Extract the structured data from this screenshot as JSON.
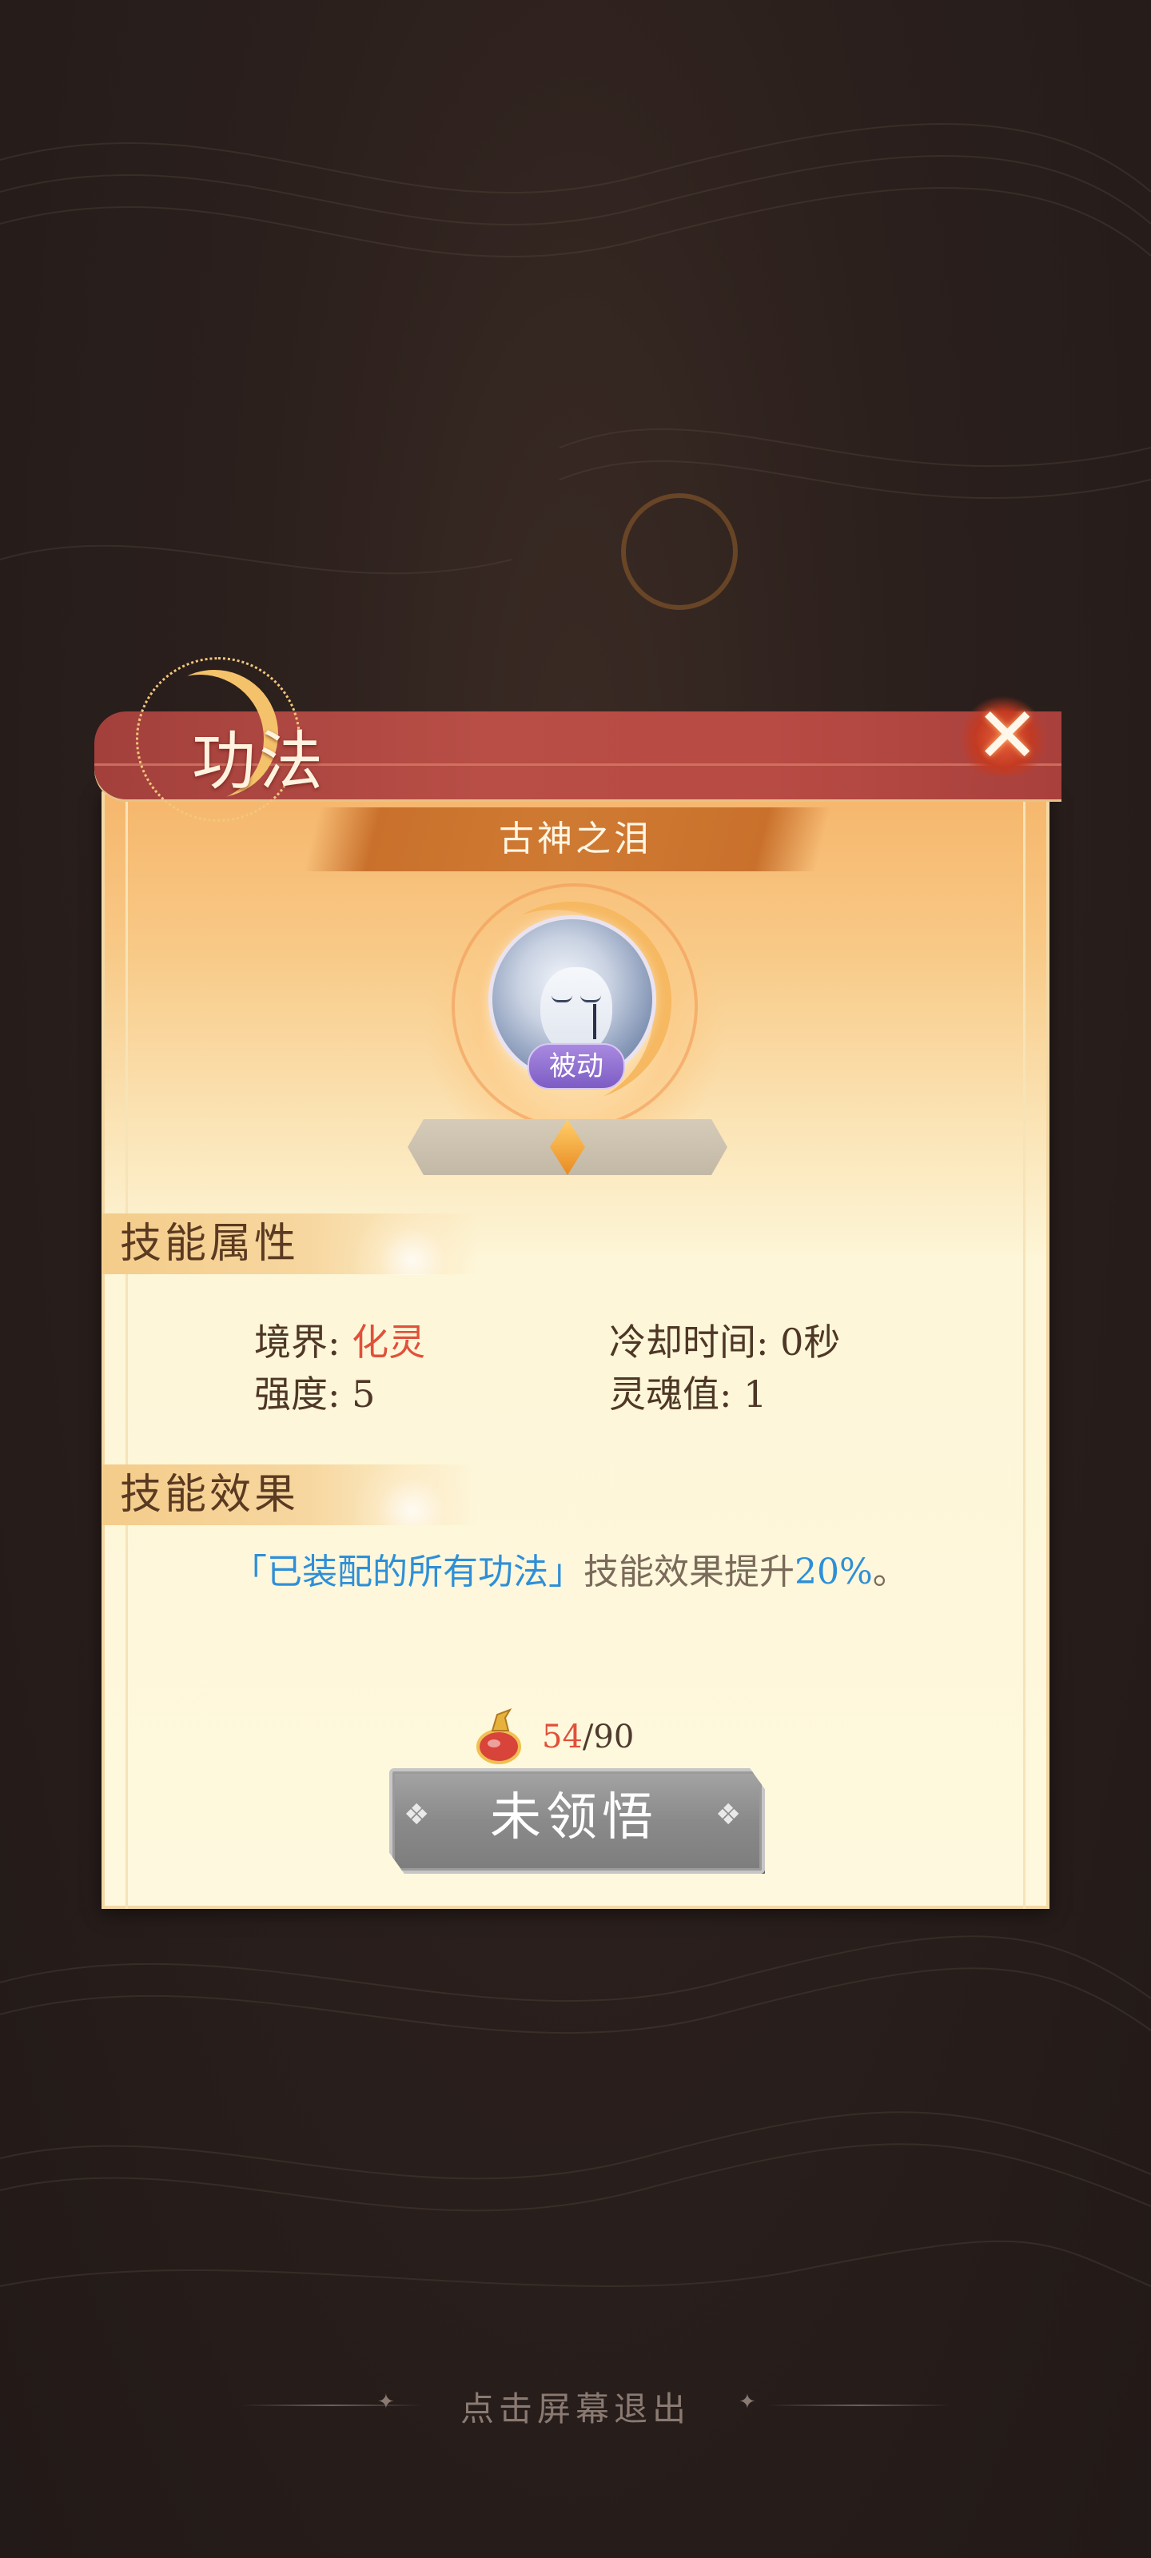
{
  "header": {
    "title": "功法"
  },
  "skill": {
    "name": "古神之泪",
    "type_badge": "被动"
  },
  "attributes": {
    "section_title": "技能属性",
    "realm_label": "境界: ",
    "realm_value": "化灵",
    "cooldown": "冷却时间: 0秒",
    "strength": "强度: 5",
    "soul_value": "灵魂值: 1"
  },
  "effect": {
    "section_title": "技能效果",
    "highlight_text": "「已装配的所有功法」",
    "body_text": "技能效果提升",
    "percent": "20%",
    "end_mark": "。"
  },
  "cost": {
    "current": "54",
    "separator_total": "/90"
  },
  "action_button": {
    "label": "未领悟"
  },
  "footer": {
    "exit_hint": "点击屏幕退出"
  },
  "colors": {
    "highlight_red": "#e0503a",
    "effect_blue": "#2e8fd8",
    "banner_red": "#b84e46",
    "passive_purple": "#8b6bd0"
  },
  "icons": [
    "close-icon",
    "moon-emblem-icon",
    "skill-orb-icon",
    "gem-icon",
    "potion-cost-icon"
  ]
}
